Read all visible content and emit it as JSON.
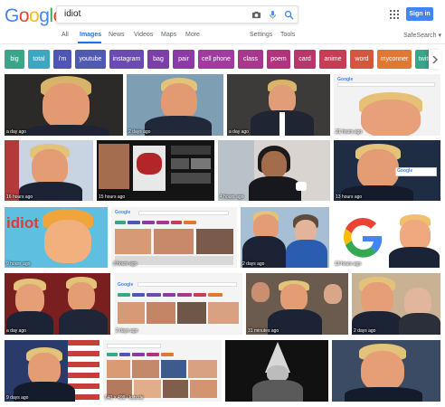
{
  "header": {
    "logo": [
      "G",
      "o",
      "o",
      "g",
      "l",
      "e"
    ],
    "search": {
      "value": "idiot"
    },
    "signin_label": "Sign in"
  },
  "tabs": [
    "All",
    "Images",
    "News",
    "Videos",
    "Maps",
    "More",
    "Settings",
    "Tools",
    "SafeSearch ▾"
  ],
  "chips": [
    {
      "label": "big",
      "color": "#39a68a"
    },
    {
      "label": "total",
      "color": "#3aa8c2"
    },
    {
      "label": "i'm",
      "color": "#4f56b8"
    },
    {
      "label": "youtube",
      "color": "#4f5ab0"
    },
    {
      "label": "instagram",
      "color": "#6a4bb3"
    },
    {
      "label": "bag",
      "color": "#7c3fa8"
    },
    {
      "label": "pair",
      "color": "#8b3aa6"
    },
    {
      "label": "cell phone",
      "color": "#a23aa0"
    },
    {
      "label": "class",
      "color": "#a8388e"
    },
    {
      "label": "poem",
      "color": "#b2327d"
    },
    {
      "label": "card",
      "color": "#b8366a"
    },
    {
      "label": "anime",
      "color": "#c73d55"
    },
    {
      "label": "word",
      "color": "#d5563f"
    },
    {
      "label": "myconner",
      "color": "#e07833"
    },
    {
      "label": "twitt",
      "color": "#39a68a"
    }
  ],
  "captions": [
    "a day ago",
    "2 days ago",
    "a day ago",
    "21 hours ago",
    "16 hours ago",
    "15 hours ago",
    "4 hours ago",
    "13 hours ago",
    "9 hours ago",
    "3 hours ago",
    "2 days ago",
    "13 hours ago",
    "a day ago",
    "2 days ago",
    "31 minutes ago",
    "2 days ago",
    "9 days ago",
    "640 × 499 - ksts.de"
  ],
  "overlay_text": {
    "idiot_banner": "idiot",
    "mini_search_1": "Google",
    "mini_search_2": "Google",
    "mini_search_3": "Google",
    "mini_search_4": "Google"
  },
  "colors": {
    "google_blue": "#4285f4",
    "google_red": "#ea4335",
    "google_yellow": "#fbbc05",
    "google_green": "#34a853",
    "active_tab": "#1a73e8"
  }
}
